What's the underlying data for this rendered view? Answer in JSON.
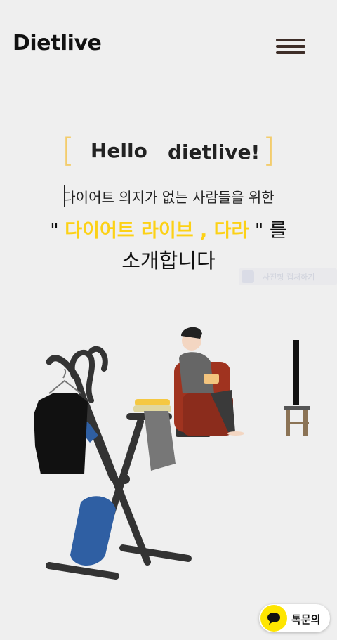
{
  "header": {
    "logo": "Dietlive",
    "menu_icon": "hamburger-menu-icon"
  },
  "hero": {
    "bracket_left": "[",
    "hello": "Hello",
    "brand": "dietlive!",
    "bracket_right": "]",
    "subtitle": "다이어트 의지가 없는 사람들을 위한",
    "line2_prefix": "\"",
    "line2_highlight": "다이어트 라이브 , 다라",
    "line2_suffix": "\" 를",
    "line3": "소개합니다"
  },
  "ghost_tooltip": {
    "text": "사진형 캡처하기"
  },
  "illustration": {
    "icon": "person-watching-tv-illustration"
  },
  "kakao": {
    "label": "톡문의",
    "icon": "kakao-chat-icon"
  },
  "colors": {
    "background": "#efefef",
    "accent_yellow": "#fcd116",
    "bracket_yellow": "#f3cc6c",
    "menu_brown": "#3e2e28"
  }
}
